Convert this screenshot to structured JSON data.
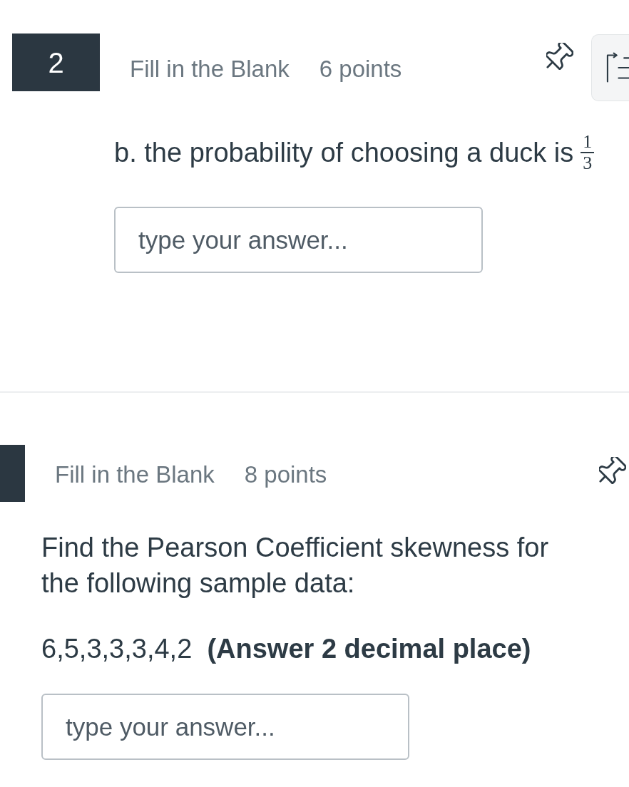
{
  "questions": [
    {
      "number": "2",
      "type": "Fill in the Blank",
      "points": "6 points",
      "panel_button": true,
      "prompt": [
        {
          "text": "b. the probability of choosing a duck is",
          "fraction": {
            "numerator": "1",
            "denominator": "3"
          }
        }
      ],
      "answer": {
        "placeholder": "type your answer..."
      }
    },
    {
      "type": "Fill in the Blank",
      "points": "8 points",
      "panel_button": false,
      "prompt": [
        {
          "text": "Find the Pearson Coefficient skewness for the following sample data:"
        },
        {
          "text": "6,5,3,3,3,4,2  **(Answer 2 decimal place)**"
        }
      ],
      "answer": {
        "placeholder": "type your answer..."
      }
    }
  ]
}
